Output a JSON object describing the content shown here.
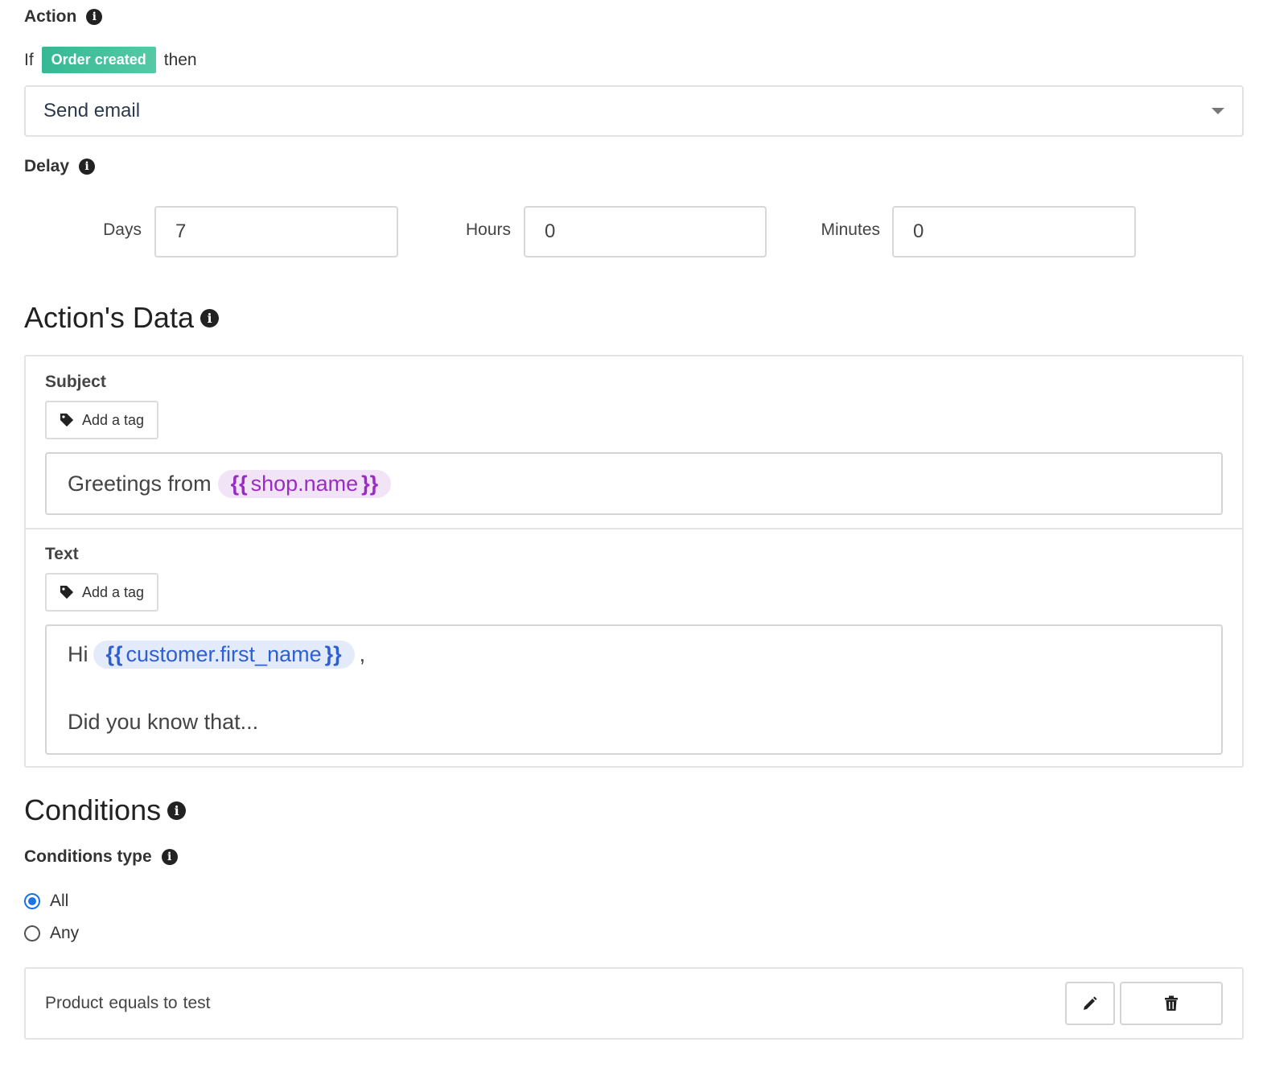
{
  "action": {
    "label": "Action",
    "info_icon": "info-circle-icon",
    "if_text": "If",
    "trigger_badge": "Order created",
    "then_text": "then",
    "selected_action": "Send email"
  },
  "delay": {
    "label": "Delay",
    "days_label": "Days",
    "days_value": "7",
    "hours_label": "Hours",
    "hours_value": "0",
    "minutes_label": "Minutes",
    "minutes_value": "0"
  },
  "actions_data": {
    "title": "Action's Data",
    "subject": {
      "label": "Subject",
      "add_tag_label": "Add a tag",
      "text_before": "Greetings from",
      "tag_open": "{{",
      "tag_name": "shop.name",
      "tag_close": "}}"
    },
    "text": {
      "label": "Text",
      "add_tag_label": "Add a tag",
      "greeting": "Hi",
      "tag_open": "{{",
      "tag_name": "customer.first_name",
      "tag_close": "}}",
      "after_tag": ",",
      "second_line": "Did you know that..."
    }
  },
  "conditions": {
    "title": "Conditions",
    "type_label": "Conditions type",
    "options": [
      {
        "label": "All",
        "checked": true
      },
      {
        "label": "Any",
        "checked": false
      }
    ],
    "rule": {
      "field": "Product",
      "operator": "equals to",
      "value": "test"
    },
    "edit_icon": "pencil-icon",
    "delete_icon": "trash-icon"
  },
  "colors": {
    "badge_green": "#35b894",
    "tag_purple": "#9a2cc4",
    "tag_blue": "#2f5fd0",
    "radio_blue": "#1a73e8"
  }
}
